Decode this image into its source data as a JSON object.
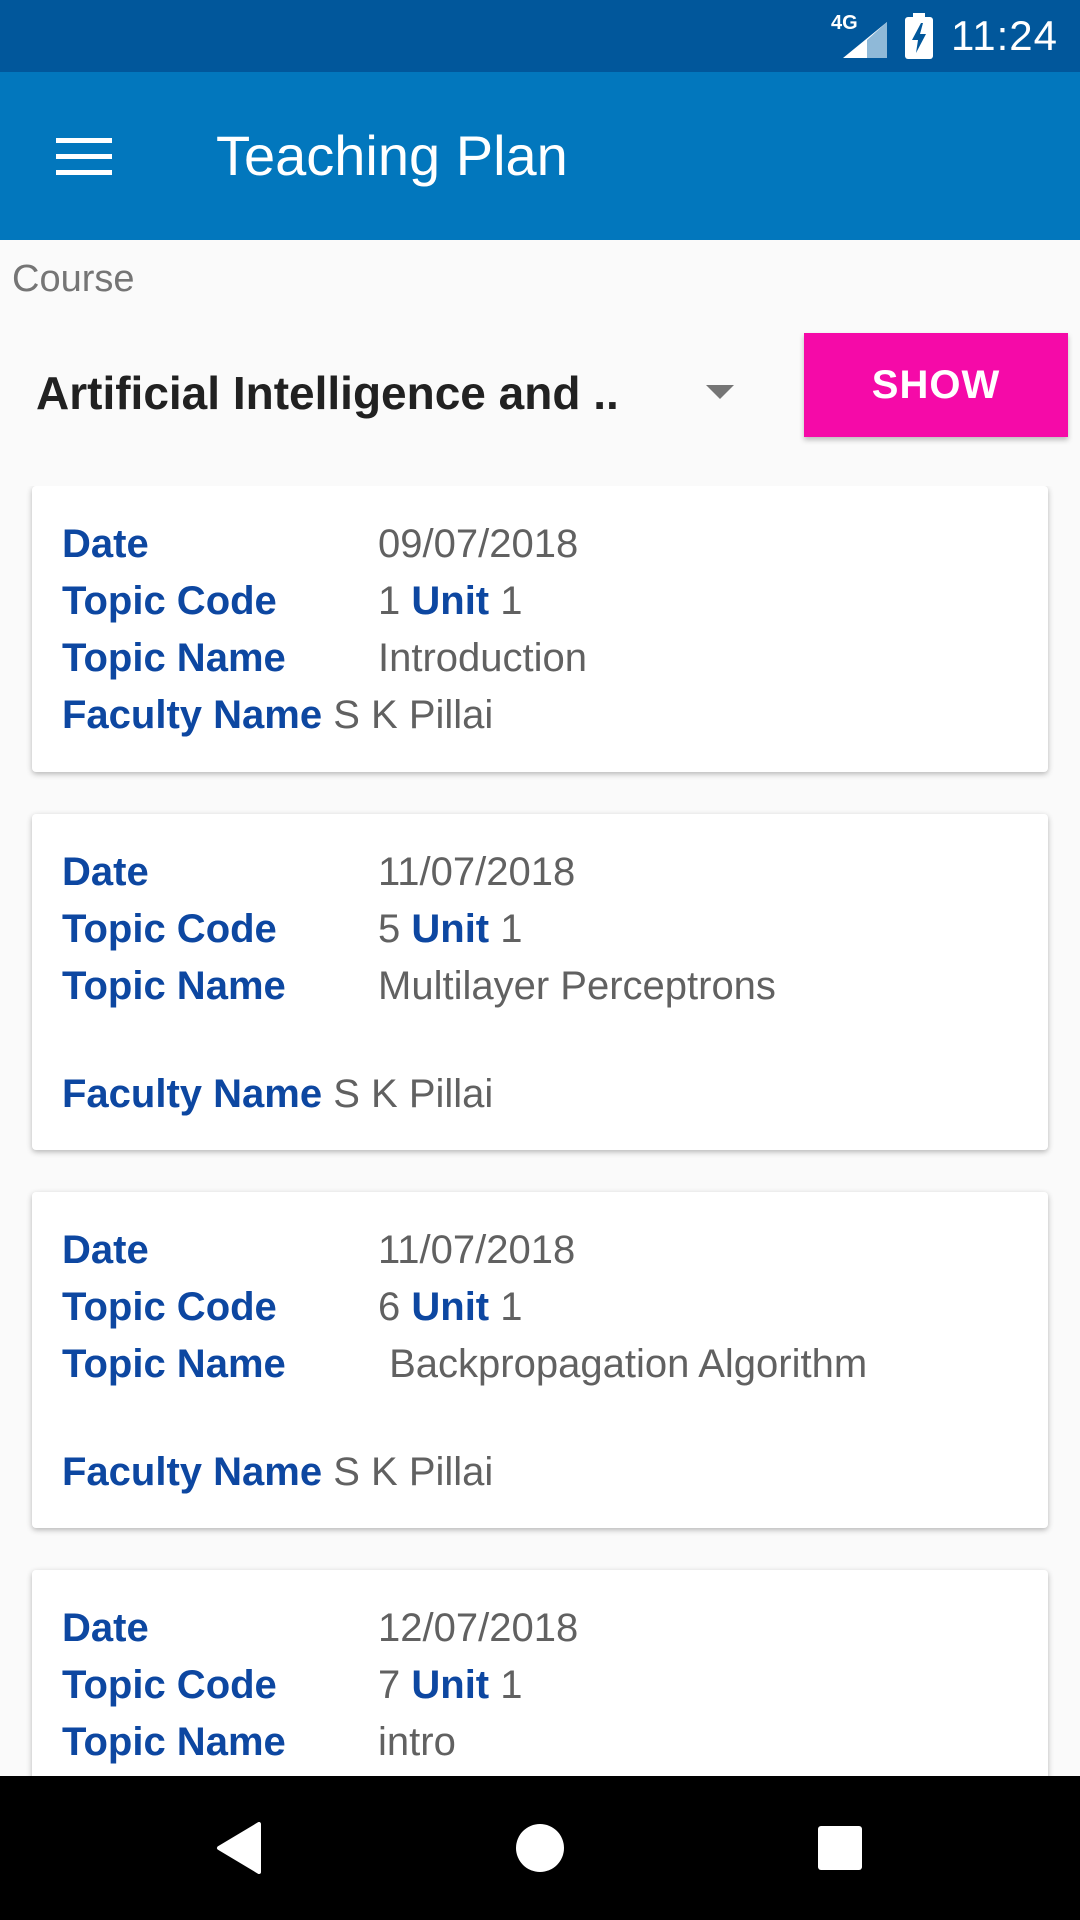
{
  "status_bar": {
    "network": "4G",
    "time": "11:24"
  },
  "app_bar": {
    "title": "Teaching Plan"
  },
  "course": {
    "label": "Course",
    "selected": "Artificial Intelligence and ..",
    "show_label": "SHOW"
  },
  "labels": {
    "date": "Date",
    "topic_code": "Topic Code",
    "unit": "Unit",
    "topic_name": "Topic Name",
    "faculty_name": "Faculty Name"
  },
  "entries": [
    {
      "date": "09/07/2018",
      "topic_code": "1",
      "unit": "1",
      "topic_name": "Introduction",
      "faculty": "S K Pillai"
    },
    {
      "date": "11/07/2018",
      "topic_code": "5",
      "unit": "1",
      "topic_name": "Multilayer Perceptrons",
      "faculty": "S K Pillai"
    },
    {
      "date": "11/07/2018",
      "topic_code": "6",
      "unit": "1",
      "topic_name": " Backpropagation Algorithm",
      "faculty": "S K Pillai"
    },
    {
      "date": "12/07/2018",
      "topic_code": "7",
      "unit": "1",
      "topic_name": "intro",
      "faculty": ""
    }
  ],
  "colors": {
    "status_bar": "#01579b",
    "app_bar": "#0277bd",
    "accent_button": "#f50aa8",
    "label_blue": "#0d47a1"
  },
  "icons": [
    "network-4g-icon",
    "signal-icon",
    "battery-charging-icon",
    "menu-icon",
    "dropdown-caret-icon",
    "back-icon",
    "home-icon",
    "recents-icon"
  ]
}
